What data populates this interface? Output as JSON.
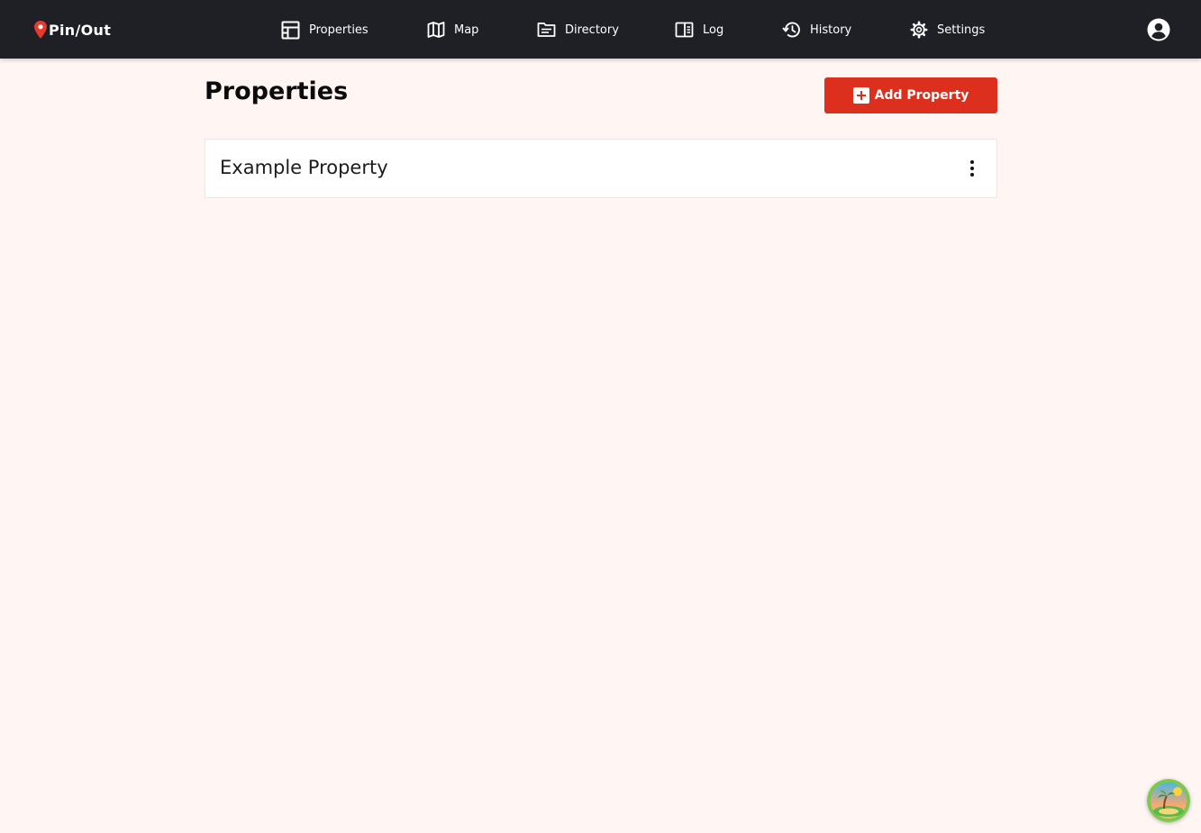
{
  "app": {
    "name": "Pin/Out"
  },
  "nav": {
    "items": [
      {
        "label": "Properties",
        "icon": "layout-icon"
      },
      {
        "label": "Map",
        "icon": "map-icon"
      },
      {
        "label": "Directory",
        "icon": "folder-icon"
      },
      {
        "label": "Log",
        "icon": "log-icon"
      },
      {
        "label": "History",
        "icon": "history-icon"
      },
      {
        "label": "Settings",
        "icon": "gear-icon"
      }
    ]
  },
  "page": {
    "title": "Properties",
    "add_button_label": "Add Property"
  },
  "properties": [
    {
      "name": "Example Property"
    }
  ],
  "colors": {
    "topbar": "#1f2026",
    "background": "#fff6f4",
    "accent": "#dc2f1e",
    "pin": "#e8392a"
  }
}
